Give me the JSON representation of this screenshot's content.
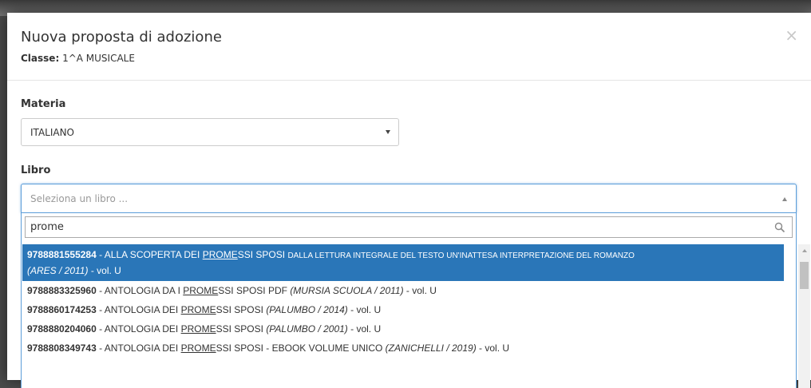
{
  "modal": {
    "title": "Nuova proposta di adozione",
    "class_label": "Classe:",
    "class_value": "1^A MUSICALE",
    "close_symbol": "×"
  },
  "form": {
    "materia_label": "Materia",
    "materia_value": "ITALIANO",
    "libro_label": "Libro",
    "libro_placeholder": "Seleziona un libro ..."
  },
  "search": {
    "value": "prome"
  },
  "results": [
    {
      "isbn": "9788881555284",
      "sep": " - ",
      "pre": "ALLA SCOPERTA DEI ",
      "hl": "PROME",
      "post": "SSI SPOSI ",
      "small": "DALLA LETTURA INTEGRALE DEL TESTO UN'INATTESA INTERPRETAZIONE DEL ROMANZO",
      "publisher": "(ARES / 2011)",
      "vol": " - vol. U"
    },
    {
      "isbn": "9788883325960",
      "sep": " - ",
      "pre": "ANTOLOGIA DA I ",
      "hl": "PROME",
      "post": "SSI SPOSI PDF ",
      "publisher": "(MURSIA SCUOLA / 2011)",
      "vol": " - vol. U"
    },
    {
      "isbn": "9788860174253",
      "sep": " - ",
      "pre": "ANTOLOGIA DEI ",
      "hl": "PROME",
      "post": "SSI SPOSI ",
      "publisher": "(PALUMBO / 2014)",
      "vol": " - vol. U"
    },
    {
      "isbn": "9788880204060",
      "sep": " - ",
      "pre": "ANTOLOGIA DEI ",
      "hl": "PROME",
      "post": "SSI SPOSI ",
      "publisher": "(PALUMBO / 2001)",
      "vol": " - vol. U"
    },
    {
      "isbn": "9788808349743",
      "sep": " - ",
      "pre": "ANTOLOGIA DEI ",
      "hl": "PROME",
      "post": "SSI SPOSI - EBOOK VOLUME UNICO ",
      "publisher": "(ZANICHELLI / 2019)",
      "vol": " - vol. U"
    }
  ],
  "colors": {
    "accent": "#2a76b8",
    "focus_border": "#5b9dd9"
  },
  "icons": {
    "search": "search-icon",
    "close": "close-icon"
  }
}
